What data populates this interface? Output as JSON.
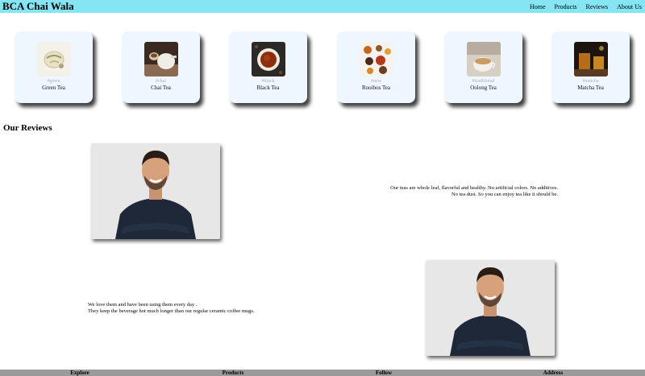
{
  "header": {
    "brand": "BCA Chai Wala",
    "nav": [
      "Home",
      "Products",
      "Reviews",
      "About Us"
    ]
  },
  "products": [
    {
      "tag": "#green",
      "name": "Green Tea",
      "image": "green-tea-photo"
    },
    {
      "tag": "#chai",
      "name": "Chai Tea",
      "image": "chai-tea-photo"
    },
    {
      "tag": "#black",
      "name": "Black Tea",
      "image": "black-tea-photo"
    },
    {
      "tag": "#new",
      "name": "Rooibos Tea",
      "image": "rooibos-tea-photo"
    },
    {
      "tag": "#traditional",
      "name": "Oolong Tea",
      "image": "oolong-tea-photo"
    },
    {
      "tag": "#matcha",
      "name": "Matcha Tea",
      "image": "matcha-tea-photo"
    }
  ],
  "reviews": {
    "title": "Our Reviews",
    "items": [
      {
        "line1": "Our teas are whole leaf, flavorful and healthy. No artificial colors. No additives.",
        "line2": "No tea dust. So you can enjoy tea like it should be."
      },
      {
        "line1": "We love them and have been using them every day .",
        "line2": "They keep the beverage hot much longer than our regular ceramic coffee mugs."
      }
    ]
  },
  "footer": {
    "columns": [
      "Explore",
      "Products",
      "Follow",
      "Address"
    ]
  }
}
